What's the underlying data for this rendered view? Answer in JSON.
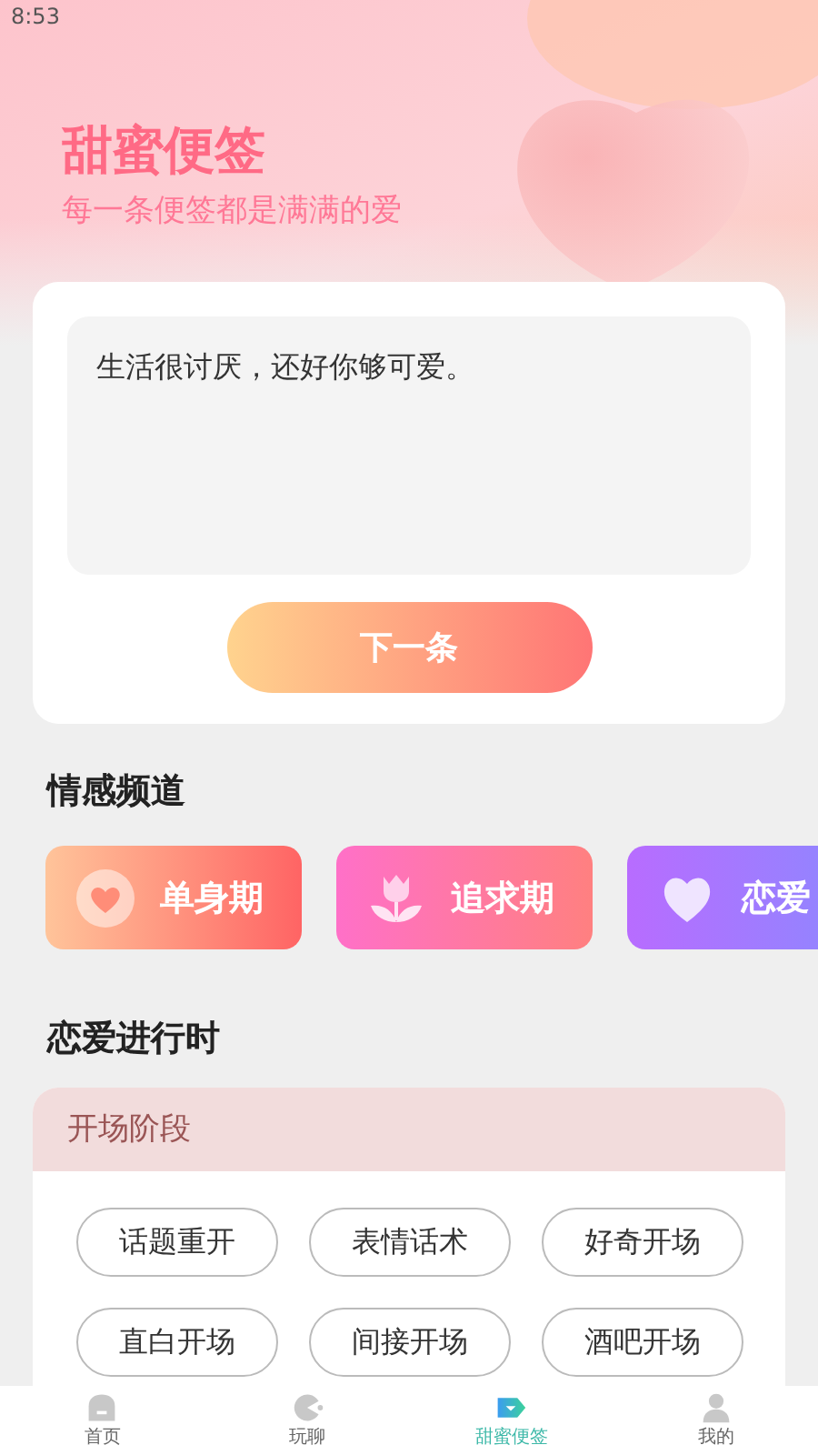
{
  "status_bar": {
    "time": "8:53"
  },
  "header": {
    "title": "甜蜜便签",
    "subtitle": "每一条便签都是满满的爱"
  },
  "note": {
    "text": "生活很讨厌，还好你够可爱。",
    "button": "下一条"
  },
  "channels": {
    "title": "情感频道",
    "items": [
      {
        "label": "单身期",
        "kind": "single"
      },
      {
        "label": "追求期",
        "kind": "pursuit"
      },
      {
        "label": "恋爱",
        "kind": "love"
      }
    ]
  },
  "progress": {
    "title": "恋爱进行时",
    "stage": "开场阶段",
    "tags": [
      "话题重开",
      "表情话术",
      "好奇开场",
      "直白开场",
      "间接开场",
      "酒吧开场"
    ]
  },
  "tab_bar": [
    {
      "label": "首页",
      "kind": "home",
      "selected": false
    },
    {
      "label": "玩聊",
      "kind": "chat",
      "selected": false
    },
    {
      "label": "甜蜜便签",
      "kind": "note",
      "selected": true
    },
    {
      "label": "我的",
      "kind": "user",
      "selected": false
    }
  ]
}
